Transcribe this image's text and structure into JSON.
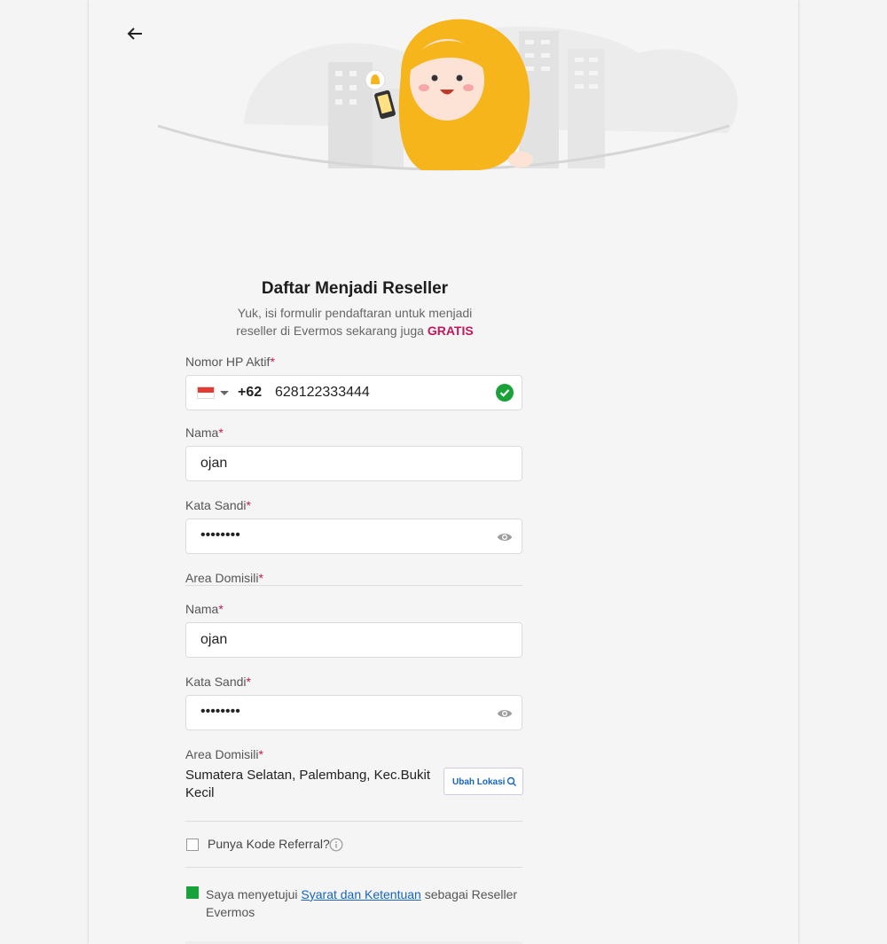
{
  "header": {
    "back_icon": "arrow-left-icon"
  },
  "intro": {
    "title": "Daftar Menjadi Reseller",
    "subtitle_line1": "Yuk, isi formulir pendaftaran untuk menjadi",
    "subtitle_line2": "reseller di Evermos sekarang juga",
    "subtitle_highlight": "GRATIS"
  },
  "phone": {
    "label": "Nomor HP Aktif",
    "country_code": "+62",
    "value": "628122333444",
    "valid": true
  },
  "form1": {
    "name_label": "Nama",
    "name_value": "ojan",
    "password_label": "Kata Sandi",
    "password_value": "••••••••",
    "area_label": "Area Domisili"
  },
  "form2": {
    "name_label": "Nama",
    "name_value": "ojan",
    "password_label": "Kata Sandi",
    "password_value": "••••••••",
    "area_label": "Area Domisili",
    "area_value_line1": "Sumatera Selatan, Palembang, Kec.Bukit",
    "area_value_line2": "Kecil",
    "change_location_button": "Ubah Lokasi"
  },
  "referral": {
    "label": "Punya Kode Referral?",
    "checked": false
  },
  "agreement": {
    "text_before": "Saya menyetujui",
    "link_text": "Syarat dan Ketentuan",
    "text_after": "sebagai Reseller",
    "text_line2": "Evermos",
    "checked": true
  },
  "colors": {
    "accent_required": "#c2185b",
    "success": "#1aa23a",
    "link": "#1565c0",
    "hijab": "#f5b51b"
  }
}
